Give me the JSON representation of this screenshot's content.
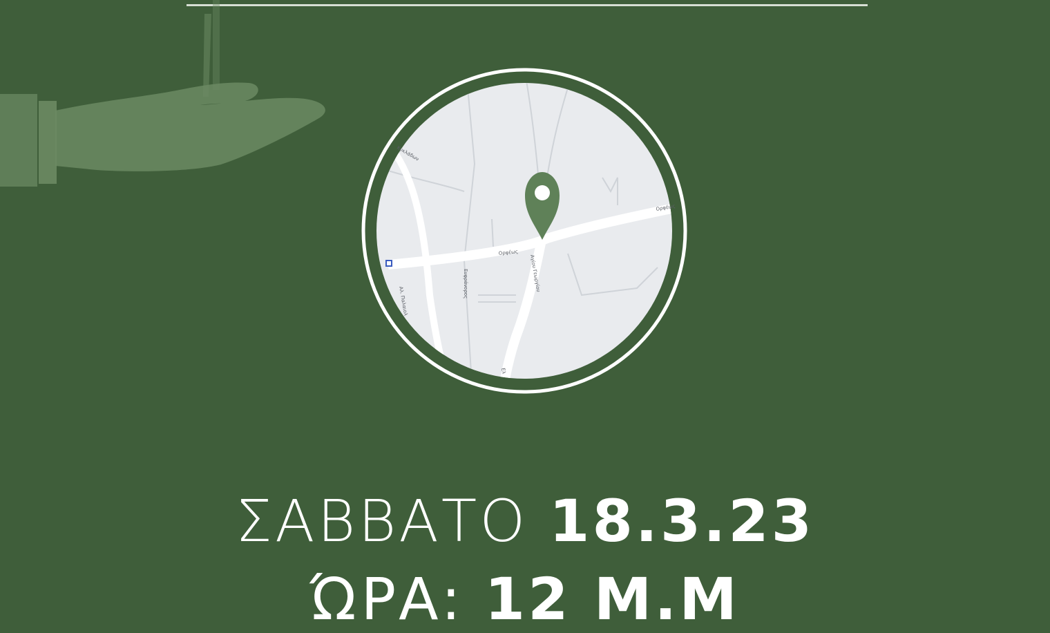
{
  "event": {
    "day_label": "ΣΑΒΒΑΤΟ",
    "date": "18.3.23",
    "time_label": "ΏΡΑ:",
    "time_value": "12 Μ.Μ"
  },
  "map": {
    "street_labels": [
      "Ορφέως",
      "Ορφέως",
      "Αλ. Παλαιολ",
      "Ευφράνορος",
      "Αγίου Γεωργίου",
      "Κυκλάδων",
      "Ελ"
    ],
    "pin_icon": "location-pin-icon",
    "transit_icon": "metro-station-icon"
  },
  "colors": {
    "background": "#3f5e3a",
    "accent": "#5f8158",
    "map_land": "#e9ebee",
    "map_road": "#ffffff",
    "ring": "#ffffff"
  }
}
